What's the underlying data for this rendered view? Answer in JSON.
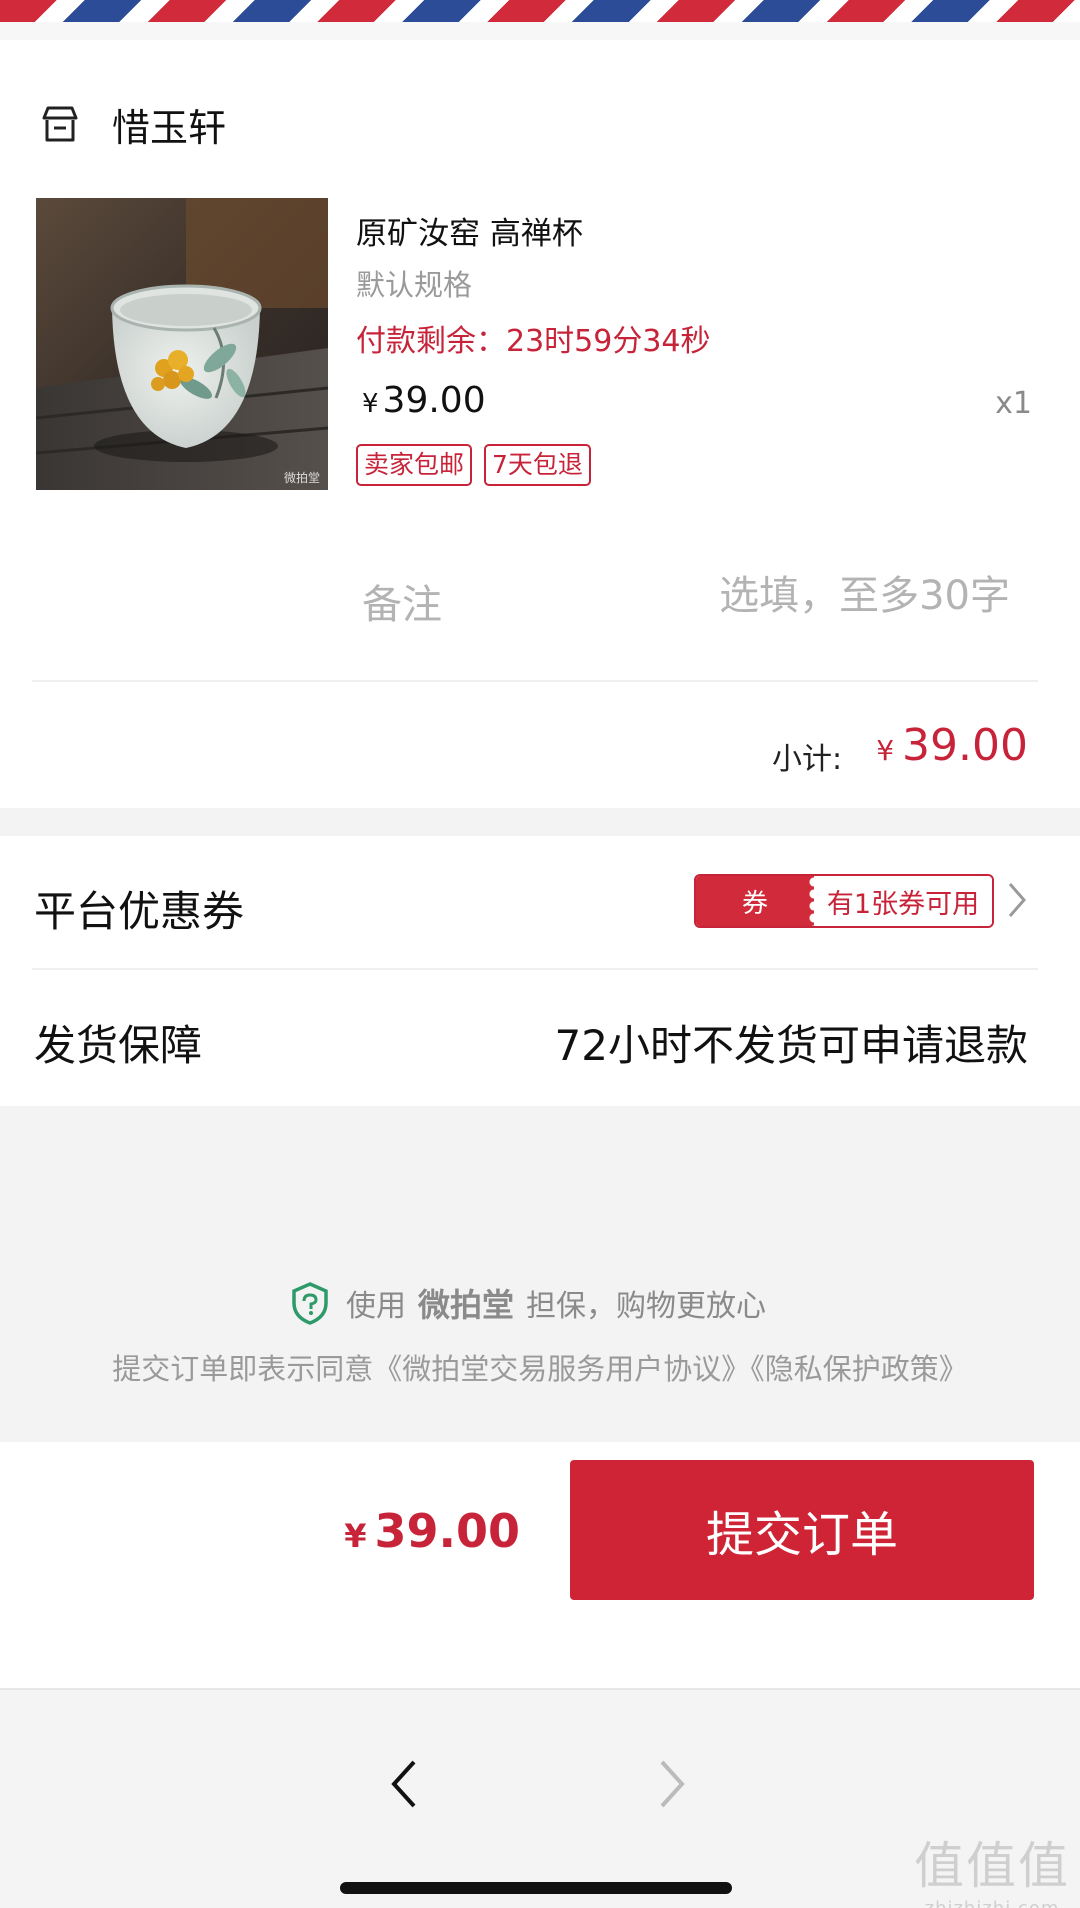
{
  "shop": {
    "name": "惜玉轩",
    "icon": "store-icon"
  },
  "product": {
    "title": "原矿汝窑 高禅杯",
    "spec": "默认规格",
    "timer": "付款剩余：23时59分34秒",
    "price_symbol": "¥",
    "price": "39.00",
    "quantity": "x1",
    "image_watermark": "微拍堂",
    "tags": [
      "卖家包邮",
      "7天包退"
    ]
  },
  "remark": {
    "label": "备注",
    "placeholder": "选填，至多30字",
    "value": ""
  },
  "subtotal": {
    "label": "小计:",
    "symbol": "¥",
    "value": "39.00"
  },
  "coupon": {
    "label": "平台优惠券",
    "badge_left": "券",
    "badge_right": "有1张券可用"
  },
  "guarantee": {
    "label": "发货保障",
    "value": "72小时不发货可申请退款"
  },
  "assurance": {
    "prefix": "使用",
    "brand": "微拍堂",
    "suffix": "担保，购物更放心"
  },
  "agreement": "提交订单即表示同意《微拍堂交易服务用户协议》《隐私保护政策》",
  "footer": {
    "symbol": "¥",
    "total": "39.00",
    "submit_label": "提交订单"
  },
  "watermark": {
    "chars": "值值值",
    "domain": "zhizhizhi.com"
  },
  "colors": {
    "accent": "#cf2435",
    "price_red": "#c7243a",
    "assurance_green": "#2e9a6a",
    "airmail_red": "#d12a3a",
    "airmail_blue": "#2c4c98"
  }
}
